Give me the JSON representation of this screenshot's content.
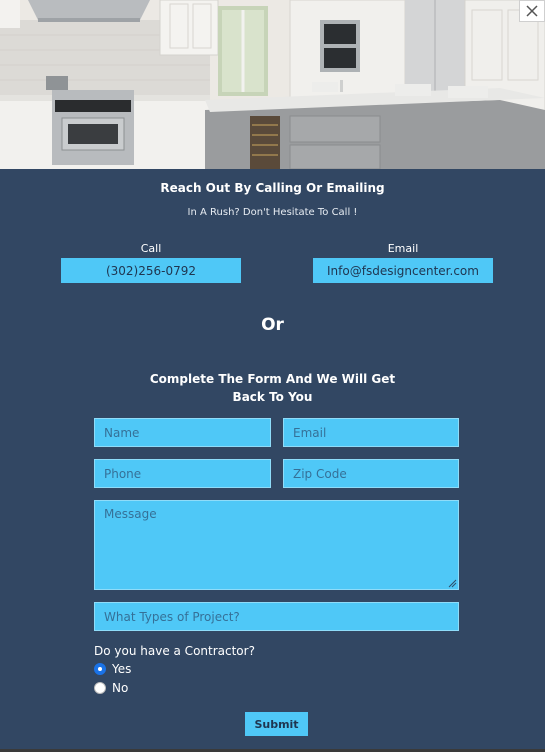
{
  "header": {
    "title": "Reach Out By Calling Or Emailing",
    "subtitle": "In A Rush? Don't Hesitate To Call !"
  },
  "contact": {
    "call_label": "Call",
    "phone": "(302)256-0792",
    "email_label": "Email",
    "email": "Info@fsdesigncenter.com"
  },
  "divider_text": "Or",
  "form": {
    "heading_line1": "Complete The Form And We Will Get",
    "heading_line2": "Back To You",
    "name_placeholder": "Name",
    "email_placeholder": "Email",
    "phone_placeholder": "Phone",
    "zip_placeholder": "Zip Code",
    "message_placeholder": "Message",
    "project_placeholder": "What Types of Project?",
    "contractor_question": "Do you have a Contractor?",
    "options": [
      {
        "label": "Yes",
        "checked": true
      },
      {
        "label": "No",
        "checked": false
      }
    ],
    "submit_label": "Submit"
  },
  "colors": {
    "panel": "#324763",
    "accent": "#4fc8f7",
    "radio_checked": "#1a73e8"
  },
  "icons": {
    "close": "close-icon"
  }
}
